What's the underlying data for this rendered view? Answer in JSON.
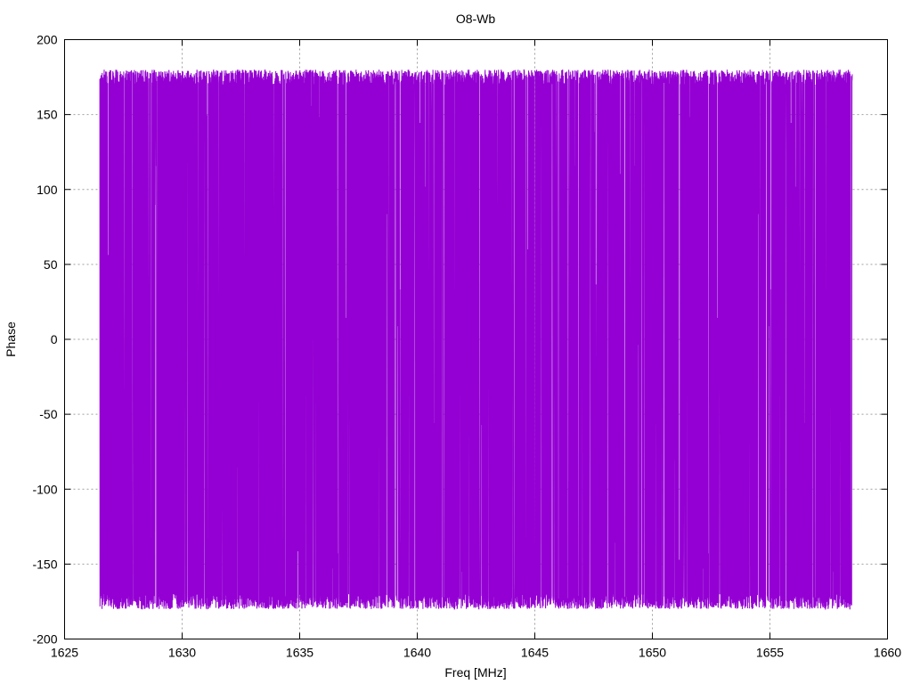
{
  "chart_data": {
    "type": "line",
    "title": "O8-Wb",
    "xlabel": "Freq [MHz]",
    "ylabel": "Phase",
    "xlim": [
      1625,
      1660
    ],
    "ylim": [
      -200,
      200
    ],
    "x_ticks": [
      1625,
      1630,
      1635,
      1640,
      1645,
      1650,
      1655,
      1660
    ],
    "y_ticks": [
      -200,
      -150,
      -100,
      -50,
      0,
      50,
      100,
      150,
      200
    ],
    "grid": true,
    "legend": "none",
    "series": [
      {
        "color": "#9400d3",
        "x_range": [
          1626.5,
          1658.5
        ],
        "y_range": [
          -180,
          180
        ],
        "description_values": "dense rapidly wrapping phase between -180 and 180 across the whole band"
      }
    ]
  }
}
